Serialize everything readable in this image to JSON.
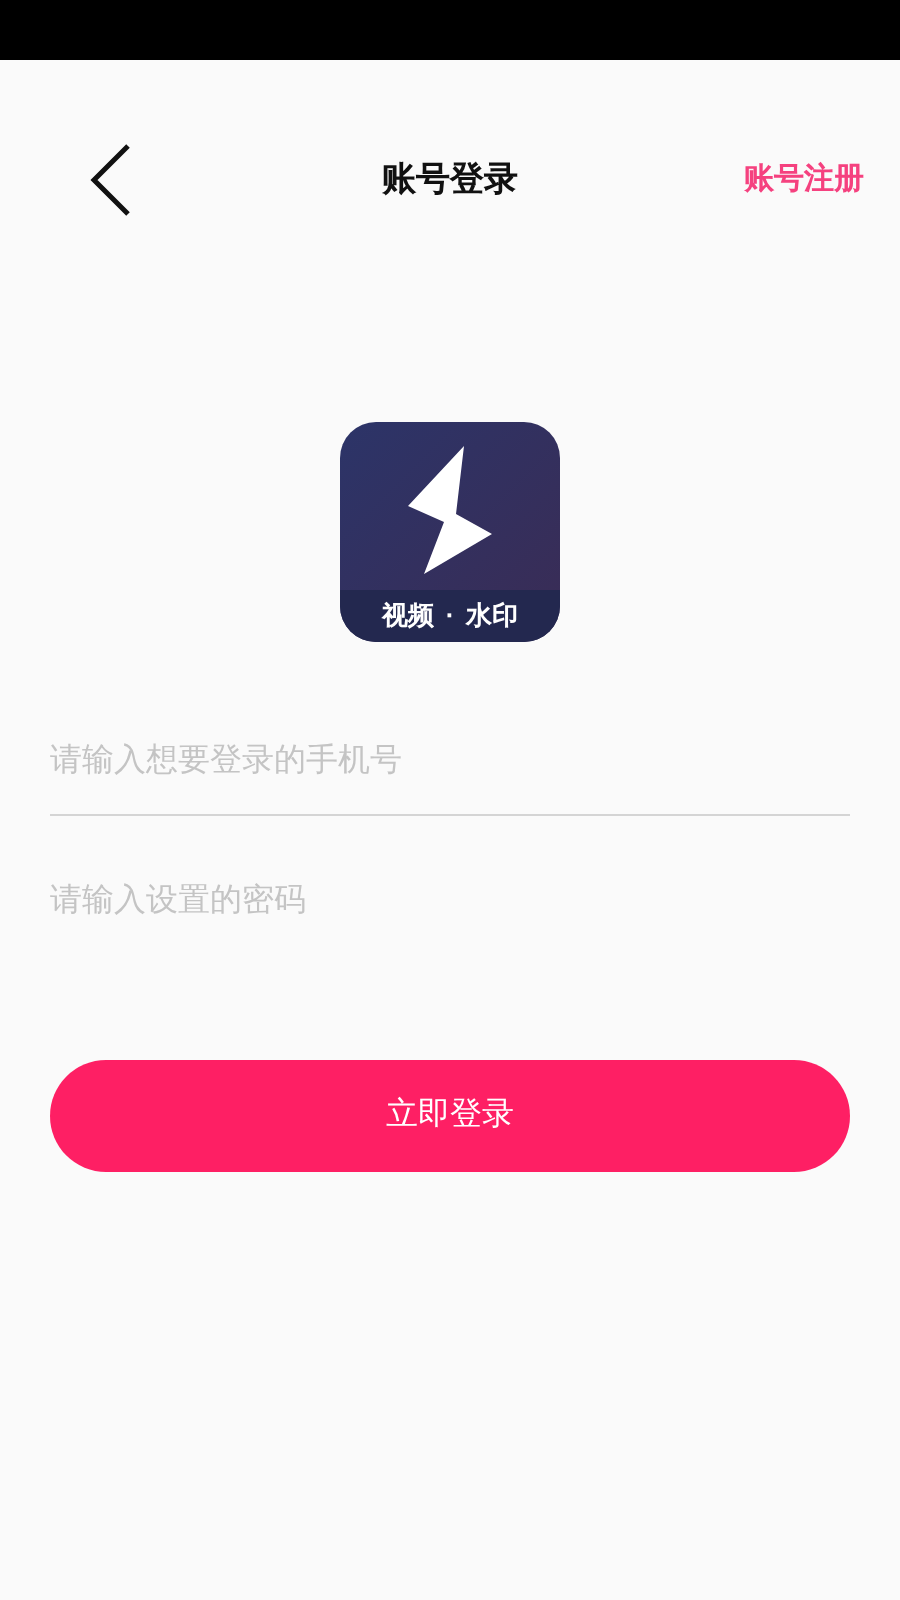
{
  "header": {
    "title": "账号登录",
    "action": "账号注册"
  },
  "logo": {
    "caption_left": "视频",
    "caption_dot": "·",
    "caption_right": "水印"
  },
  "fields": [
    {
      "placeholder": "请输入想要登录的手机号",
      "underline": true
    },
    {
      "placeholder": "请输入设置的密码",
      "underline": false
    }
  ],
  "login_button": "立即登录"
}
